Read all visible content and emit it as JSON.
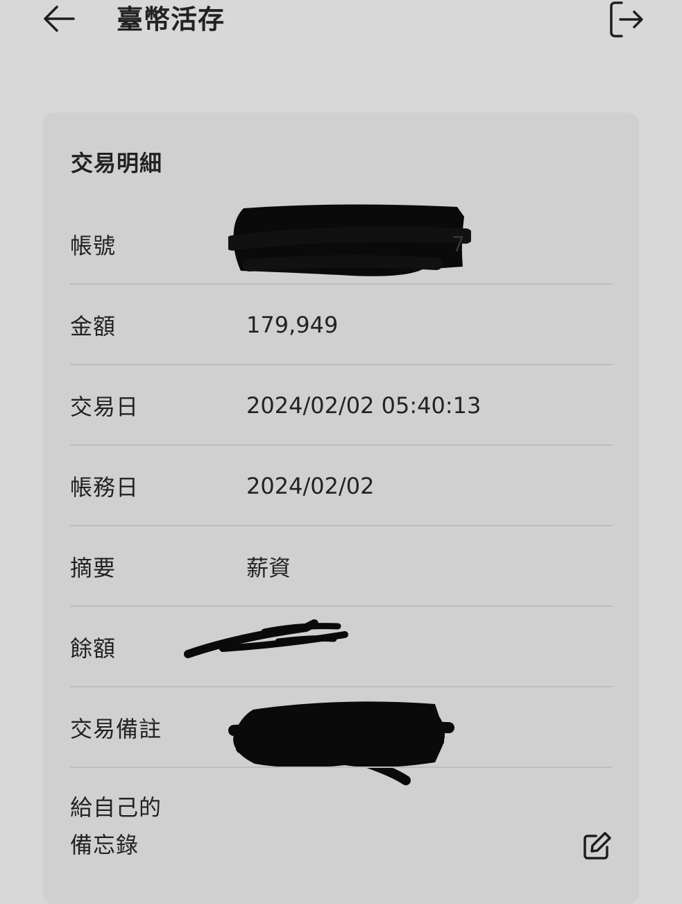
{
  "header": {
    "title": "臺幣活存",
    "back_icon": "arrow-left-icon",
    "logout_icon": "logout-icon"
  },
  "card": {
    "title": "交易明細",
    "rows": [
      {
        "label": "帳號",
        "value": ""
      },
      {
        "label": "金額",
        "value": "179,949"
      },
      {
        "label": "交易日",
        "value": "2024/02/02 05:40:13"
      },
      {
        "label": "帳務日",
        "value": "2024/02/02"
      },
      {
        "label": "摘要",
        "value": "薪資"
      },
      {
        "label": "餘額",
        "value": ""
      },
      {
        "label": "交易備註",
        "value": ""
      }
    ],
    "memo": {
      "label_line1": "給自己的",
      "label_line2": "備忘錄",
      "edit_icon": "edit-icon"
    }
  }
}
